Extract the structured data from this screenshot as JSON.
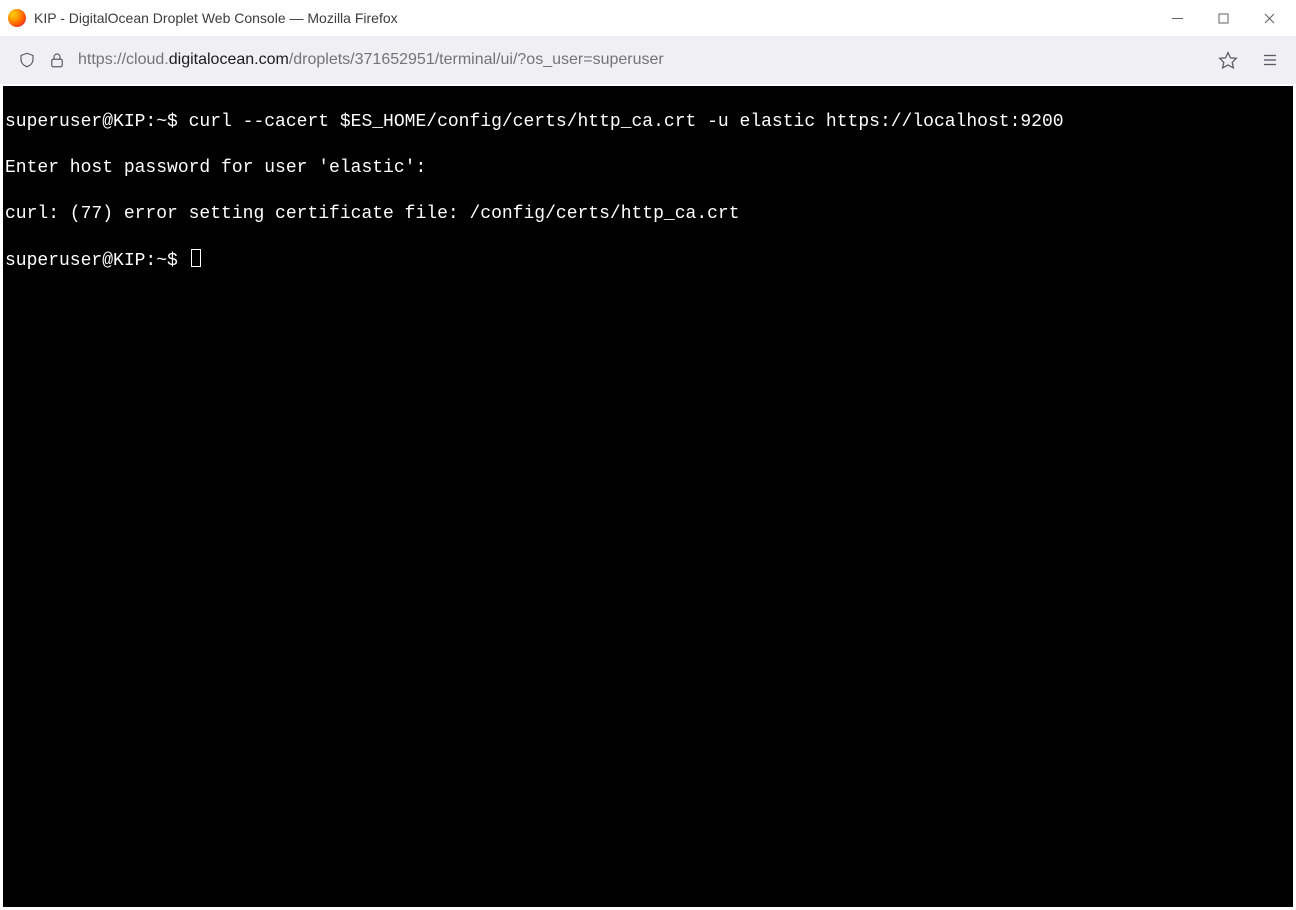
{
  "window": {
    "title": "KIP - DigitalOcean Droplet Web Console — Mozilla Firefox"
  },
  "urlbar": {
    "proto": "https://",
    "sub": "cloud.",
    "host": "digitalocean.com",
    "path": "/droplets/371652951/terminal/ui/?os_user=superuser"
  },
  "terminal": {
    "lines": [
      "superuser@KIP:~$ curl --cacert $ES_HOME/config/certs/http_ca.crt -u elastic https://localhost:9200",
      "Enter host password for user 'elastic':",
      "curl: (77) error setting certificate file: /config/certs/http_ca.crt"
    ],
    "prompt": "superuser@KIP:~$ "
  }
}
